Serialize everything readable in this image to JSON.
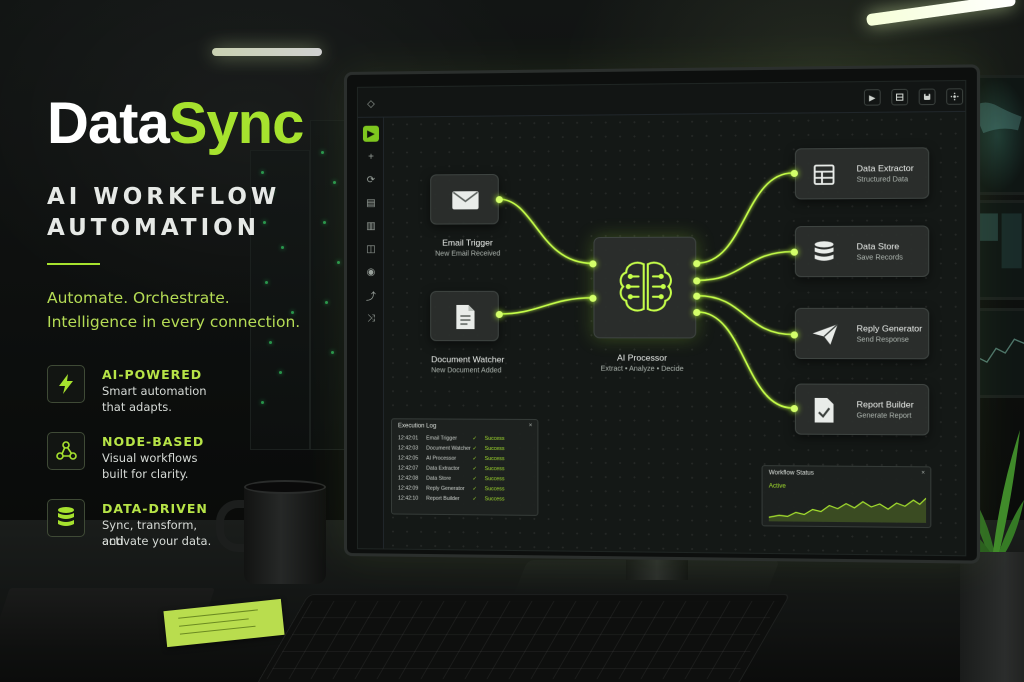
{
  "brand": {
    "word1": "Data",
    "word2": "Sync"
  },
  "tagline": {
    "line1": "AI WORKFLOW",
    "line2": "AUTOMATION"
  },
  "slogan": {
    "line1": "Automate. Orchestrate.",
    "line2": "Intelligence in every connection."
  },
  "features": [
    {
      "icon": "lightning-icon",
      "title": "AI-POWERED",
      "line1": "Smart automation",
      "line2": "that adapts."
    },
    {
      "icon": "network-nodes-icon",
      "title": "NODE-BASED",
      "line1": "Visual workflows",
      "line2": "built for clarity."
    },
    {
      "icon": "database-icon",
      "title": "DATA-DRIVEN",
      "line1": "Sync, transform, and",
      "line2": "activate your data."
    }
  ],
  "colors": {
    "accent": "#a6e22e",
    "port_glow": "#d4ff6a",
    "background": "#0b0d0c"
  },
  "toolbar": {
    "buttons": [
      "play-icon",
      "layout-icon",
      "save-icon",
      "settings-icon"
    ],
    "play_glyph": "▶"
  },
  "sidebar": {
    "items": [
      "pointer-icon",
      "play-icon",
      "add-icon",
      "sync-icon",
      "clipboard-icon",
      "document-icon",
      "settings-icon",
      "play-circle-icon",
      "analytics-icon",
      "share-icon"
    ],
    "glyphs": [
      "◇",
      "▶",
      "+",
      "⟳",
      "▤",
      "▥",
      "◫",
      "◉",
      "⤴",
      "⤨"
    ]
  },
  "nodes": {
    "email_trigger": {
      "title": "Email Trigger",
      "subtitle": "New Email Received",
      "icon": "envelope-icon"
    },
    "document_watcher": {
      "title": "Document Watcher",
      "subtitle": "New Document Added",
      "icon": "document-icon"
    },
    "ai_processor": {
      "title": "AI Processor",
      "subtitle": "Extract • Analyze • Decide",
      "icon": "brain-circuit-icon"
    },
    "data_extractor": {
      "title": "Data Extractor",
      "subtitle": "Structured Data",
      "icon": "table-icon"
    },
    "data_store": {
      "title": "Data Store",
      "subtitle": "Save Records",
      "icon": "database-icon"
    },
    "reply_generator": {
      "title": "Reply Generator",
      "subtitle": "Send Response",
      "icon": "paper-plane-icon"
    },
    "report_builder": {
      "title": "Report Builder",
      "subtitle": "Generate Report",
      "icon": "report-check-icon"
    }
  },
  "execution_log": {
    "title": "Execution Log",
    "close": "×",
    "rows": [
      {
        "time": "12:42:01",
        "node": "Email Trigger",
        "check": "✓",
        "status": "Success"
      },
      {
        "time": "12:42:03",
        "node": "Document Watcher",
        "check": "✓",
        "status": "Success"
      },
      {
        "time": "12:42:05",
        "node": "AI Processor",
        "check": "✓",
        "status": "Success"
      },
      {
        "time": "12:42:07",
        "node": "Data Extractor",
        "check": "✓",
        "status": "Success"
      },
      {
        "time": "12:42:08",
        "node": "Data Store",
        "check": "✓",
        "status": "Success"
      },
      {
        "time": "12:42:09",
        "node": "Reply Generator",
        "check": "✓",
        "status": "Success"
      },
      {
        "time": "12:42:10",
        "node": "Report Builder",
        "check": "✓",
        "status": "Success"
      }
    ]
  },
  "workflow_status": {
    "title": "Workflow Status",
    "close": "×",
    "state": "Active"
  }
}
